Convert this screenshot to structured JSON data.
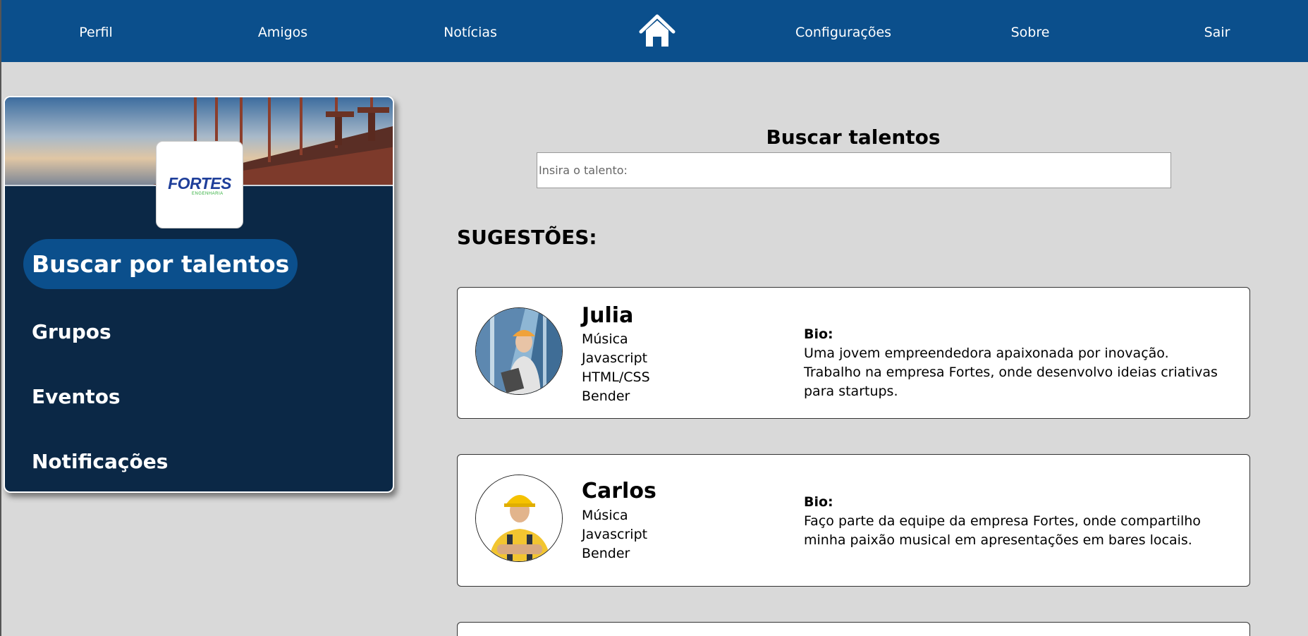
{
  "nav": {
    "items": [
      "Perfil",
      "Amigos",
      "Notícias",
      "Configurações",
      "Sobre",
      "Sair"
    ]
  },
  "sidebar": {
    "logo_text": "FORTES",
    "logo_subtext": "ENGENHARIA",
    "active_item": "Buscar por talentos",
    "items": [
      "Grupos",
      "Eventos",
      "Notificações"
    ]
  },
  "search": {
    "title": "Buscar talentos",
    "placeholder": "Insira o talento:"
  },
  "suggestions": {
    "title": "SUGESTÕES:",
    "cards": [
      {
        "name": "Julia",
        "skills": [
          "Música",
          "Javascript",
          "HTML/CSS",
          "Bender"
        ],
        "bio_label": "Bio:",
        "bio": "Uma jovem empreendedora apaixonada por inovação. Trabalho na empresa Fortes, onde desenvolvo ideias criativas para startups."
      },
      {
        "name": "Carlos",
        "skills": [
          "Música",
          "Javascript",
          "Bender"
        ],
        "bio_label": "Bio:",
        "bio": "Faço parte da equipe da empresa Fortes, onde compartilho minha paixão musical em apresentações em bares locais."
      }
    ]
  },
  "colors": {
    "nav_bg": "#0b4f8c",
    "sidebar_bg": "#0b2846",
    "page_bg": "#d9d9d9"
  }
}
